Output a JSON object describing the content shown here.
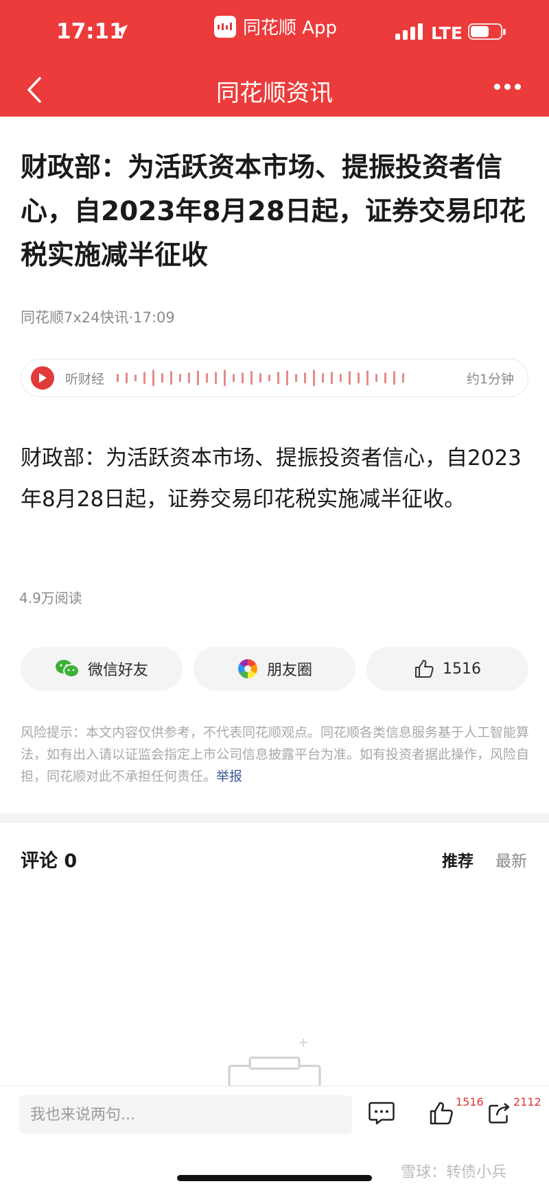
{
  "status_bar": {
    "time": "17:11",
    "app_name": "同花顺 App",
    "network": "LTE"
  },
  "nav": {
    "title": "同花顺资讯"
  },
  "article": {
    "headline": "财政部：为活跃资本市场、提振投资者信心，自2023年8月28日起，证券交易印花税实施减半征收",
    "source": "同花顺7x24快讯·17:09",
    "audio_label": "听财经",
    "audio_duration": "约1分钟",
    "body": "财政部：为活跃资本市场、提振投资者信心，自2023年8月28日起，证券交易印花税实施减半征收。",
    "reads": "4.9万阅读"
  },
  "share": {
    "wechat_label": "微信好友",
    "moments_label": "朋友圈",
    "like_count": "1516"
  },
  "disclaimer": {
    "text": "风险提示：本文内容仅供参考，不代表同花顺观点。同花顺各类信息服务基于人工智能算法，如有出入请以证监会指定上市公司信息披露平台为准。如有投资者据此操作，风险自担，同花顺对此不承担任何责任。",
    "report_link": "举报"
  },
  "comments": {
    "title": "评论 0",
    "tab_recommended": "推荐",
    "tab_latest": "最新"
  },
  "bottom_bar": {
    "input_placeholder": "我也来说两句...",
    "like_count": "1516",
    "share_count": "2112"
  },
  "watermark": "雪球：转债小兵",
  "colors": {
    "brand_red": "#ec3b3b",
    "wechat_green": "#3cb034",
    "link_blue": "#3a5a9a"
  },
  "icons": {
    "back": "back-chevron-icon",
    "more": "more-dots-icon",
    "play": "play-icon",
    "wechat": "wechat-icon",
    "moments": "moments-icon",
    "like": "thumbs-up-icon",
    "comment": "comment-bubble-icon",
    "share": "share-icon"
  }
}
